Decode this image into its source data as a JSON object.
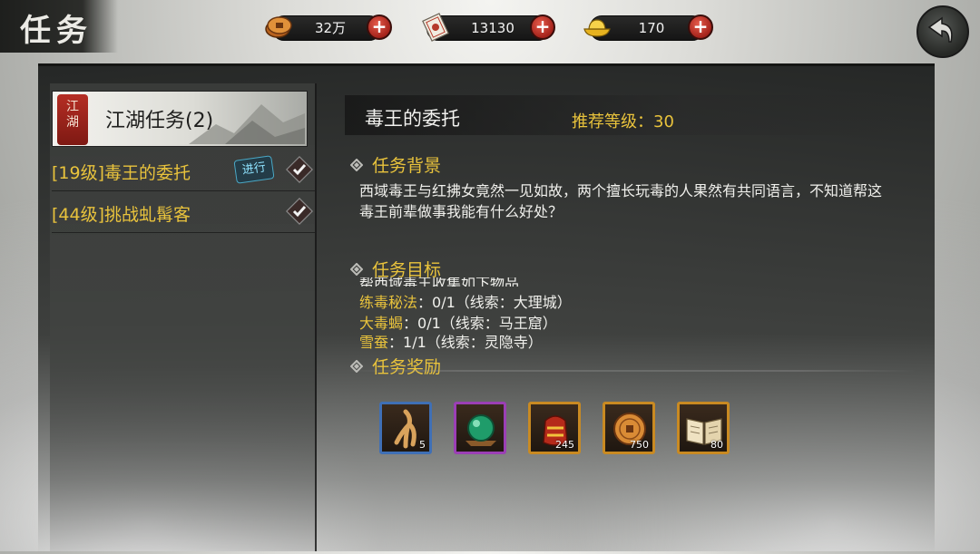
{
  "header": {
    "title": "任务",
    "resources": [
      {
        "icon": "copper-coin-icon",
        "value": "32万"
      },
      {
        "icon": "scroll-ticket-icon",
        "value": "13130"
      },
      {
        "icon": "gold-ingot-icon",
        "value": "170"
      }
    ],
    "plus_label": "+"
  },
  "sidebar": {
    "category_seal": "江湖",
    "category_label": "江湖任务(2)",
    "tasks": [
      {
        "label": "[19级]毒王的委托",
        "status": "进行"
      },
      {
        "label": "[44级]挑战虬髯客",
        "status": ""
      }
    ]
  },
  "quest": {
    "title": "毒王的委托",
    "recommended_level": "推荐等级：30",
    "background_header": "任务背景",
    "background_text": "西域毒王与红拂女竟然一见如故，两个擅长玩毒的人果然有共同语言，不知道帮这毒王前辈做事我能有什么好处？",
    "objectives_header": "任务目标",
    "objectives_partial": "帮西域毒王收集如下物品",
    "objectives": [
      {
        "name": "练毒秘法",
        "progress": "：0/1（线索：大理城）"
      },
      {
        "name": "大毒蝎",
        "progress": "：0/1（线索：马王窟）"
      },
      {
        "name": "雪蚕",
        "progress": "：1/1（线索：灵隐寺）"
      }
    ],
    "rewards_header": "任务奖励",
    "rewards": [
      {
        "icon": "ginseng-root-icon",
        "qty": "5",
        "border": "#3f6fb5"
      },
      {
        "icon": "jade-orb-icon",
        "qty": "",
        "border": "#9b3fb5"
      },
      {
        "icon": "experience-pill-icon",
        "qty": "245",
        "border": "#c98a22"
      },
      {
        "icon": "copper-coin-icon",
        "qty": "750",
        "border": "#c98a22"
      },
      {
        "icon": "book-icon",
        "qty": "80",
        "border": "#c98a22"
      }
    ]
  }
}
